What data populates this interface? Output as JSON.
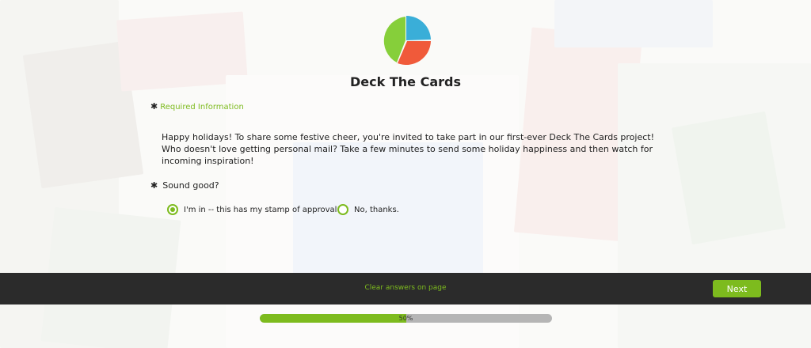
{
  "survey": {
    "title": "Deck The Cards",
    "required_label": "Required Information",
    "intro": "Happy holidays! To share some festive cheer, you're invited to take part in our first-ever Deck The Cards project! Who doesn't love getting personal mail? Take a few minutes to send some holiday happiness and then watch for incoming inspiration!",
    "question": "Sound good?",
    "required_marker": "✱",
    "options": [
      {
        "label": "I'm in -- this has my stamp of approval!",
        "selected": true
      },
      {
        "label": "No, thanks.",
        "selected": false
      }
    ]
  },
  "footer": {
    "clear_label": "Clear answers on page",
    "next_label": "Next"
  },
  "progress": {
    "value": 0.5,
    "label": "50%"
  },
  "colors": {
    "accent": "#7dbb1e",
    "logo_blue": "#3aaed8",
    "logo_red": "#f05a3a",
    "logo_green": "#86cf3a",
    "footer_bg": "#2b2b2b"
  },
  "icons": {
    "logo": "pie-logo-icon",
    "required": "asterisk-icon"
  }
}
